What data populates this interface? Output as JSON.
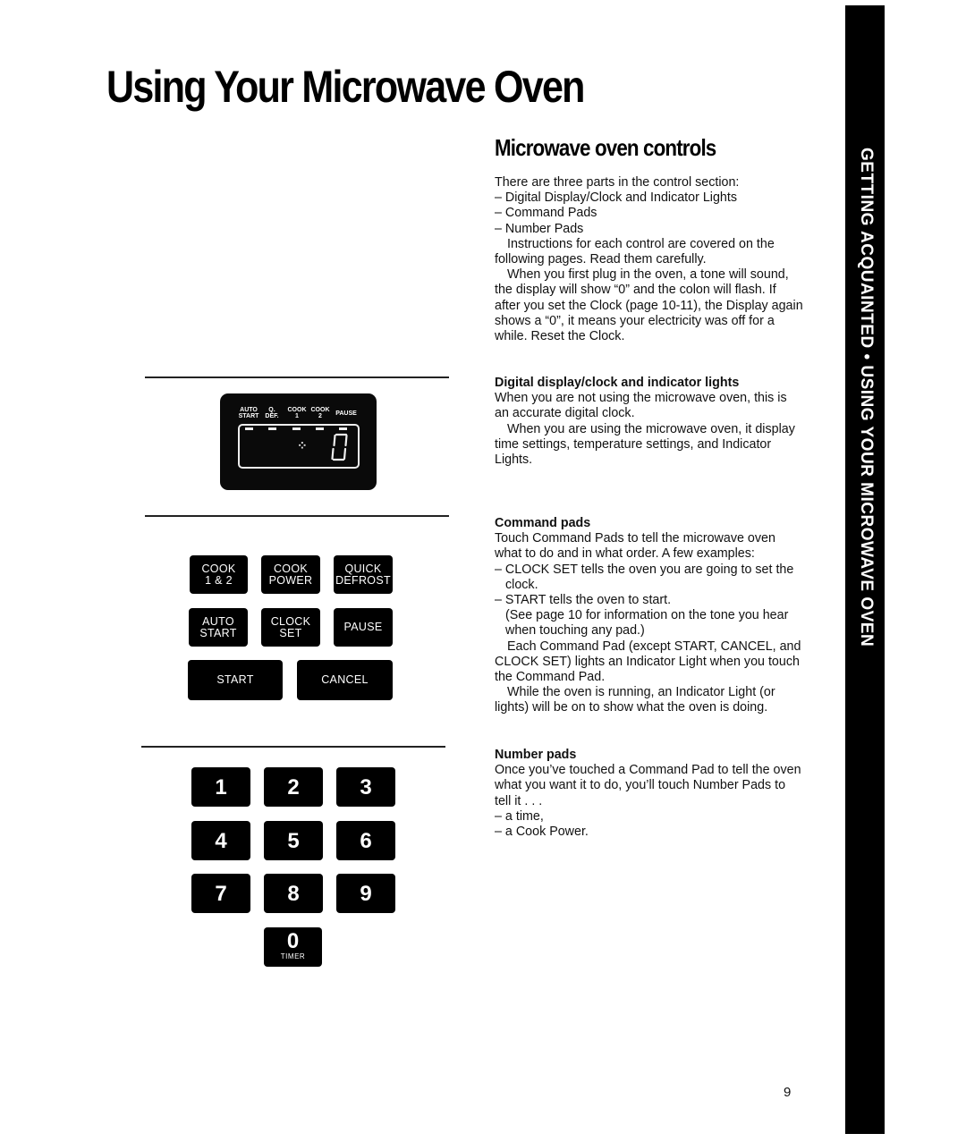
{
  "page": {
    "title": "Using Your Microwave Oven",
    "side_tab": "GETTING ACQUAINTED • USING YOUR MICROWAVE OVEN",
    "page_number": "9"
  },
  "section": {
    "heading": "Microwave oven controls",
    "intro": {
      "lead": "There are three parts in the control section:",
      "parts": [
        "– Digital Display/Clock and Indicator Lights",
        "– Command Pads",
        "– Number Pads"
      ],
      "p1": "Instructions for each control are covered on the following pages. Read them carefully.",
      "p2": "When you first plug in the oven, a tone will sound, the display will show “0” and the colon will flash. If after you set the Clock (page 10-11), the Display again shows a “0”, it means your electricity was off for a while. Reset the Clock."
    },
    "display": {
      "heading": "Digital display/clock and indicator lights",
      "p1": "When you are not using the microwave oven, this is an accurate digital clock.",
      "p2": "When you are using the microwave oven, it display time settings, temperature settings, and Indicator Lights."
    },
    "command": {
      "heading": "Command pads",
      "p1": "Touch Command Pads to tell the microwave oven what to do and in what order. A few examples:",
      "ex1": "– CLOCK SET tells the oven you are going to set the clock.",
      "ex2": "– START tells the oven to start.",
      "note": "(See page 10 for information on the tone you hear when touching any pad.)",
      "p2": "Each Command Pad (except START, CANCEL, and CLOCK SET) lights an Indicator Light when you touch the Command Pad.",
      "p3": "While the oven is running, an Indicator Light (or lights) will be on to show what the oven is doing."
    },
    "number": {
      "heading": "Number pads",
      "p1": "Once you’ve touched a Command Pad to tell the oven what you want it to do, you’ll touch Number Pads to tell it . . .",
      "items": [
        "– a time,",
        "– a Cook Power."
      ]
    }
  },
  "display_panel": {
    "indicators": [
      {
        "top": "AUTO",
        "bottom": "START"
      },
      {
        "top": "Q.",
        "bottom": "DEF."
      },
      {
        "top": "COOK",
        "bottom": "1"
      },
      {
        "top": "COOK",
        "bottom": "2"
      },
      {
        "top": "PAUSE",
        "bottom": ""
      }
    ],
    "colon": "⁘",
    "readout": "0"
  },
  "command_pads": [
    {
      "label": "COOK\n1 & 2"
    },
    {
      "label": "COOK\nPOWER"
    },
    {
      "label": "QUICK\nDEFROST"
    },
    {
      "label": "AUTO\nSTART"
    },
    {
      "label": "CLOCK\nSET"
    },
    {
      "label": "PAUSE"
    },
    {
      "label": "START"
    },
    {
      "label": "CANCEL"
    }
  ],
  "number_pads": [
    {
      "digit": "1"
    },
    {
      "digit": "2"
    },
    {
      "digit": "3"
    },
    {
      "digit": "4"
    },
    {
      "digit": "5"
    },
    {
      "digit": "6"
    },
    {
      "digit": "7"
    },
    {
      "digit": "8"
    },
    {
      "digit": "9"
    },
    {
      "digit": "0",
      "sub": "TIMER"
    }
  ]
}
